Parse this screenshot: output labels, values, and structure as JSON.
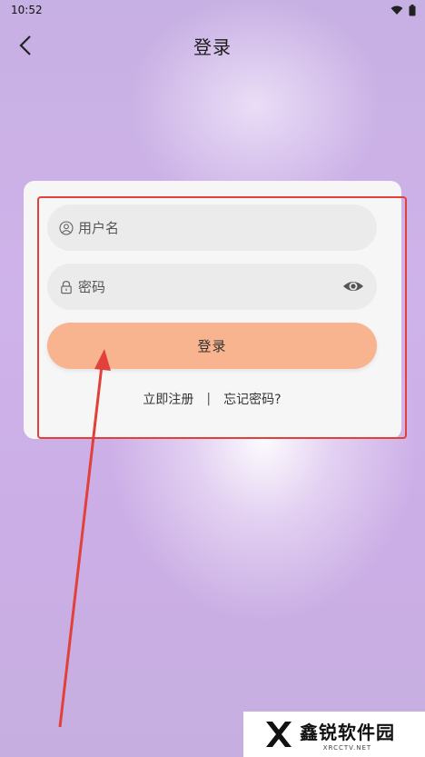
{
  "status_bar": {
    "time": "10:52"
  },
  "header": {
    "title": "登录"
  },
  "form": {
    "username_placeholder": "用户名",
    "password_placeholder": "密码",
    "login_label": "登录",
    "register_link": "立即注册",
    "separator": "|",
    "forgot_link": "忘记密码?"
  },
  "watermark": {
    "title": "鑫锐软件园",
    "subtitle": "XRCCTV.NET"
  },
  "colors": {
    "login_button": "#f8b48f",
    "annotation": "#e2403a",
    "card": "#f6f6f6",
    "input": "#ebebeb"
  },
  "icons": {
    "back": "back-arrow-icon",
    "user": "user-icon",
    "lock": "lock-icon",
    "eye": "eye-icon",
    "wifi": "wifi-icon",
    "battery": "battery-icon"
  }
}
